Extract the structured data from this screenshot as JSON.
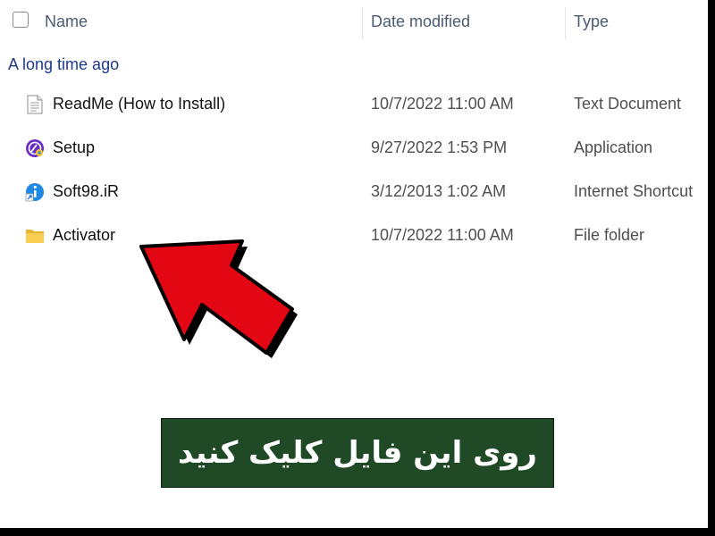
{
  "header": {
    "name_label": "Name",
    "date_label": "Date modified",
    "type_label": "Type"
  },
  "group_label": "A long time ago",
  "files": [
    {
      "name": "ReadMe (How to Install)",
      "date": "10/7/2022 11:00 AM",
      "type": "Text Document",
      "icon": "text-document-icon"
    },
    {
      "name": "Setup",
      "date": "9/27/2022 1:53 PM",
      "type": "Application",
      "icon": "setup-app-icon"
    },
    {
      "name": "Soft98.iR",
      "date": "3/12/2013 1:02 AM",
      "type": "Internet Shortcut",
      "icon": "internet-shortcut-icon"
    },
    {
      "name": "Activator",
      "date": "10/7/2022 11:00 AM",
      "type": "File folder",
      "icon": "folder-icon"
    }
  ],
  "banner_text": "روی این فایل کلیک کنید",
  "colors": {
    "arrow": "#e30613",
    "banner_bg": "#1f4a25",
    "group_text": "#1f3a8a"
  }
}
